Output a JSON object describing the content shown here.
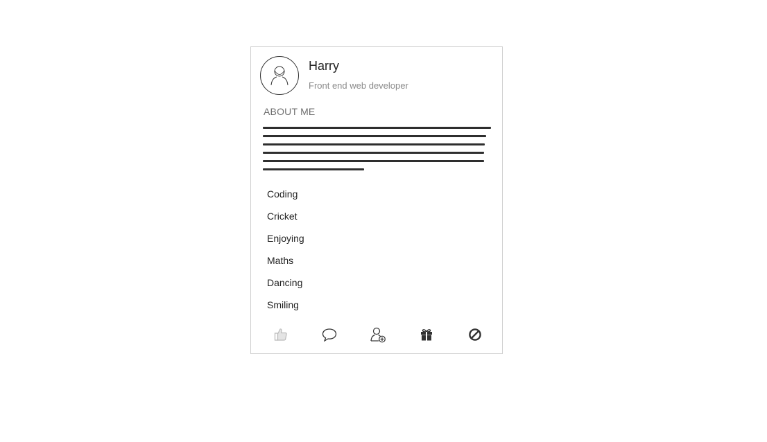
{
  "profile": {
    "name": "Harry",
    "role": "Front end web developer",
    "avatar_icon": "user-avatar-icon"
  },
  "about": {
    "heading": "ABOUT ME"
  },
  "interests": [
    "Coding",
    "Cricket",
    "Enjoying",
    "Maths",
    "Dancing",
    "Smiling"
  ],
  "actions": [
    {
      "name": "like-icon",
      "label": "Like"
    },
    {
      "name": "comment-icon",
      "label": "Comment"
    },
    {
      "name": "add-friend-icon",
      "label": "Add friend"
    },
    {
      "name": "gift-icon",
      "label": "Gift"
    },
    {
      "name": "block-icon",
      "label": "Block"
    }
  ],
  "colors": {
    "border": "#cfcfcf",
    "text": "#222222",
    "muted": "#8a8a8a",
    "icon": "#333333"
  }
}
